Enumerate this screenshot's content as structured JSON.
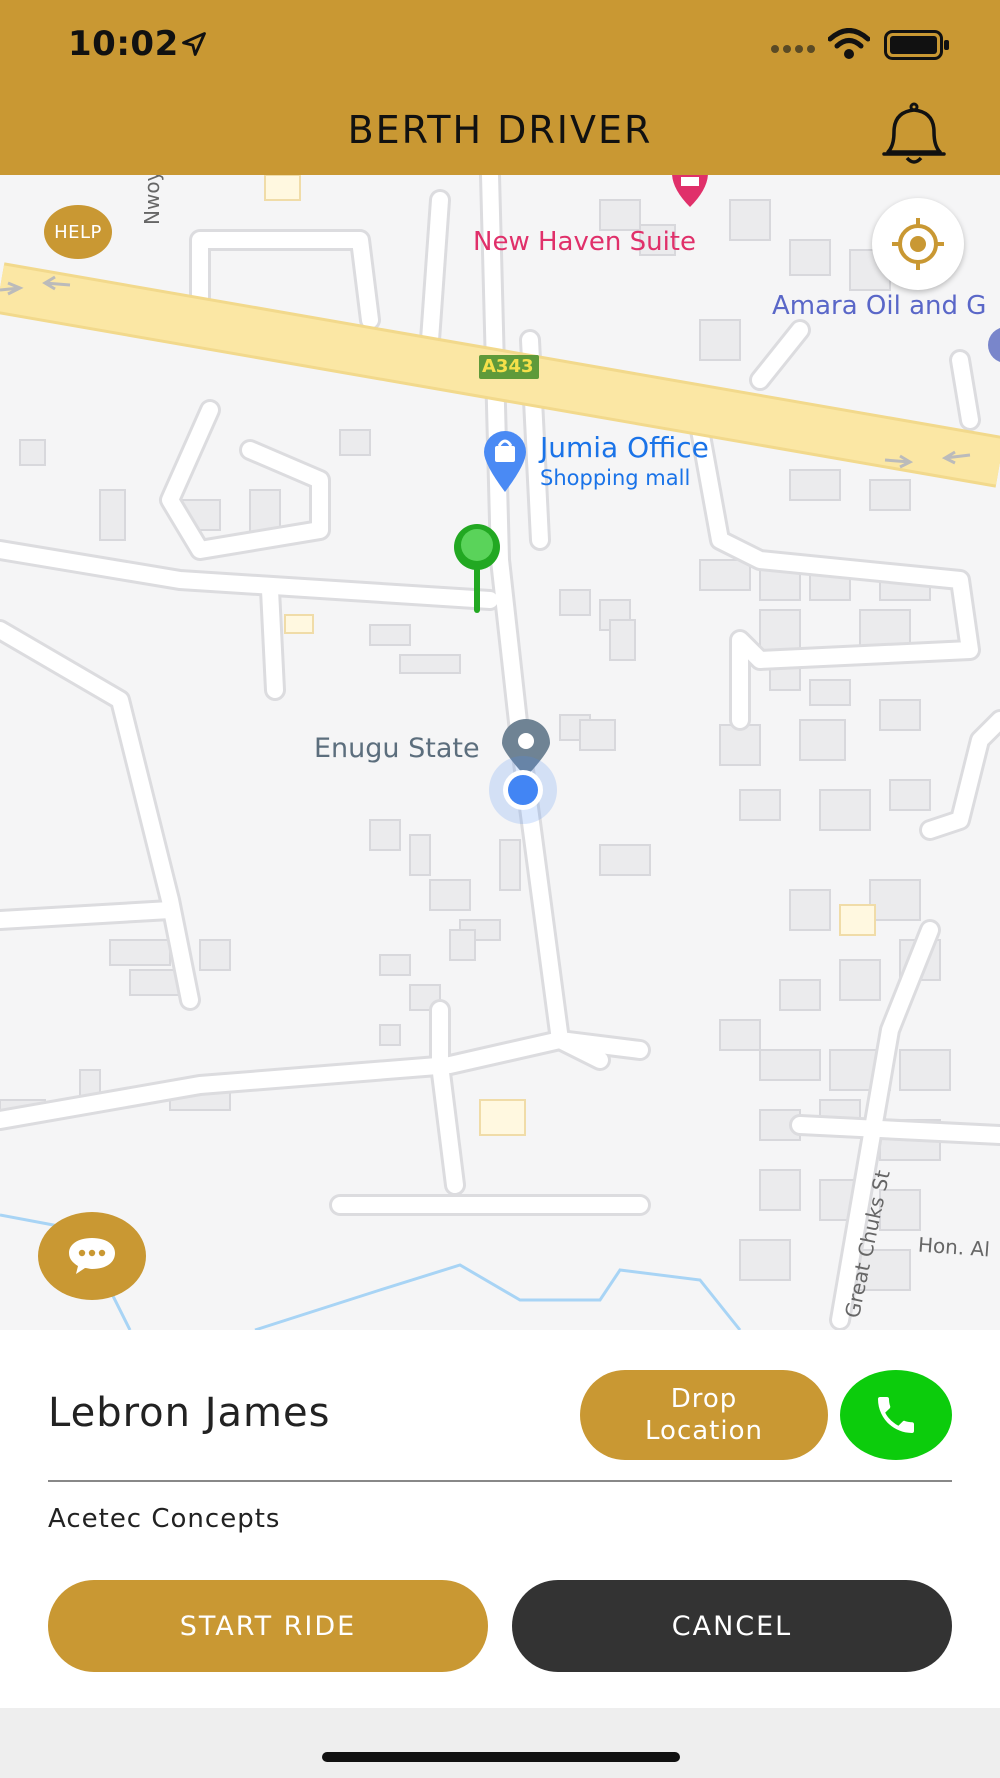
{
  "status_bar": {
    "time": "10:02",
    "icons": [
      "location-arrow-icon",
      "signal-icon",
      "wifi-icon",
      "battery-icon"
    ]
  },
  "header": {
    "title": "BERTH DRIVER",
    "bell_icon": "bell-icon"
  },
  "map": {
    "help_label": "HELP",
    "road_badge": "A343",
    "poi_new_haven": "New Haven Suite",
    "poi_amara": "Amara Oil and G",
    "poi_jumia": "Jumia Office",
    "poi_jumia_sub": "Shopping mall",
    "area_label": "Enugu State",
    "street_nwoy": "Nwoy",
    "street_great_chuks": "Great Chuks St",
    "street_hon": "Hon. Al"
  },
  "ride": {
    "rider_name": "Lebron James",
    "drop_location_label": "Drop Location",
    "company": "Acetec Concepts",
    "start_label": "START RIDE",
    "cancel_label": "CANCEL"
  },
  "colors": {
    "brand": "#c99833",
    "call_green": "#0ccc0c",
    "cancel_dark": "#333333",
    "poi_pink": "#e0306a",
    "poi_blue": "#1a73e8"
  }
}
